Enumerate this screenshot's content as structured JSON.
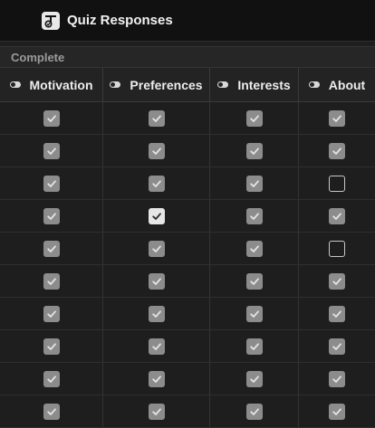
{
  "window": {
    "title": "Quiz Responses",
    "icon": "quiz-responses-app-icon"
  },
  "group": {
    "label": "Complete"
  },
  "columns": [
    {
      "label": "Motivation",
      "icon": "toggle-icon"
    },
    {
      "label": "Preferences",
      "icon": "toggle-icon"
    },
    {
      "label": "Interests",
      "icon": "toggle-icon"
    },
    {
      "label": "About",
      "icon": "toggle-icon"
    }
  ],
  "rows": [
    {
      "Motivation": true,
      "Preferences": true,
      "Interests": true,
      "About": true
    },
    {
      "Motivation": true,
      "Preferences": true,
      "Interests": true,
      "About": true
    },
    {
      "Motivation": true,
      "Preferences": true,
      "Interests": true,
      "About": false
    },
    {
      "Motivation": true,
      "Preferences": true,
      "Interests": true,
      "About": true
    },
    {
      "Motivation": true,
      "Preferences": true,
      "Interests": true,
      "About": false
    },
    {
      "Motivation": true,
      "Preferences": true,
      "Interests": true,
      "About": true
    },
    {
      "Motivation": true,
      "Preferences": true,
      "Interests": true,
      "About": true
    },
    {
      "Motivation": true,
      "Preferences": true,
      "Interests": true,
      "About": true
    },
    {
      "Motivation": true,
      "Preferences": true,
      "Interests": true,
      "About": true
    },
    {
      "Motivation": true,
      "Preferences": true,
      "Interests": true,
      "About": true
    }
  ],
  "highlighted_cell": {
    "row": 3,
    "column": "Preferences"
  },
  "colors": {
    "background": "#1e1e1e",
    "titlebar": "#111111",
    "checkbox_checked": "#8c8c8c",
    "checkbox_highlight": "#e6e6e6"
  }
}
